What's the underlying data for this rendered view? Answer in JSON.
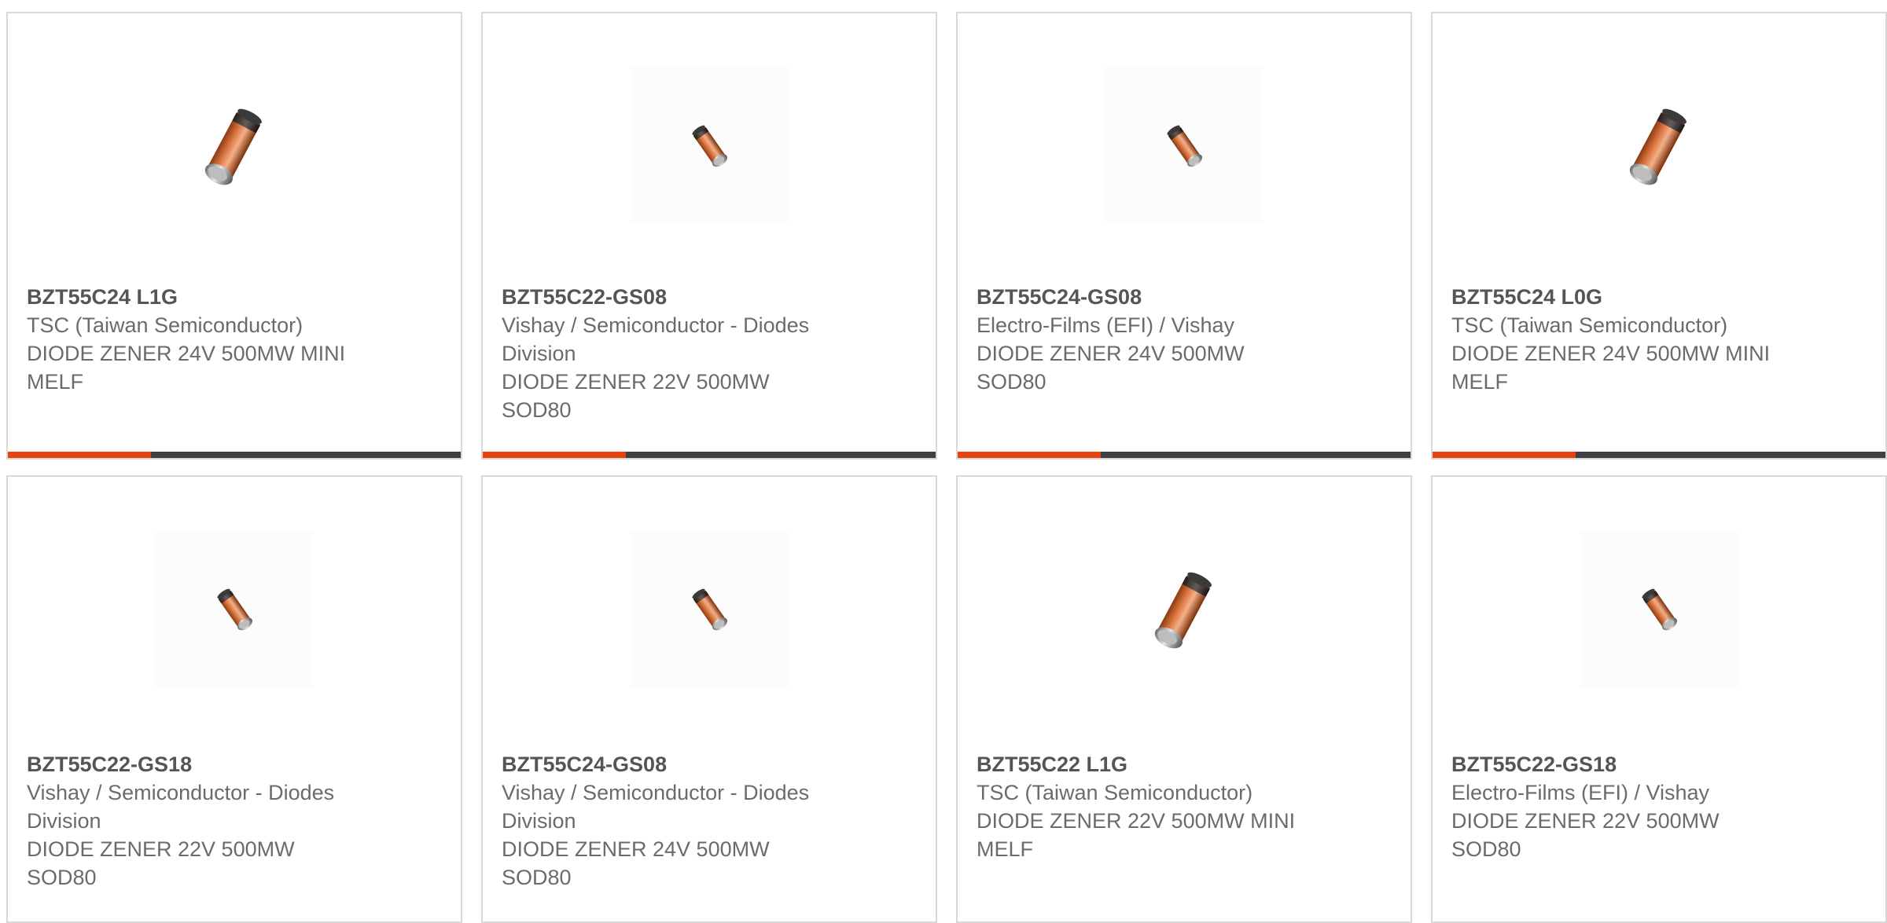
{
  "accent_color": "#e8420e",
  "bar_color": "#3f3f3f",
  "products": [
    {
      "part_number": "BZT55C24 L1G",
      "manufacturer": "TSC (Taiwan Semiconductor)",
      "description": "DIODE ZENER 24V 500MW MINI MELF",
      "image": "diode-large-icon"
    },
    {
      "part_number": "BZT55C22-GS08",
      "manufacturer": "Vishay / Semiconductor - Diodes Division",
      "description": "DIODE ZENER 22V 500MW SOD80",
      "image": "diode-small-icon"
    },
    {
      "part_number": "BZT55C24-GS08",
      "manufacturer": "Electro-Films (EFI) / Vishay",
      "description": "DIODE ZENER 24V 500MW SOD80",
      "image": "diode-small-icon"
    },
    {
      "part_number": "BZT55C24 L0G",
      "manufacturer": "TSC (Taiwan Semiconductor)",
      "description": "DIODE ZENER 24V 500MW MINI MELF",
      "image": "diode-large-icon"
    },
    {
      "part_number": "BZT55C22-GS18",
      "manufacturer": "Vishay / Semiconductor - Diodes Division",
      "description": "DIODE ZENER 22V 500MW SOD80",
      "image": "diode-small-icon"
    },
    {
      "part_number": "BZT55C24-GS08",
      "manufacturer": "Vishay / Semiconductor - Diodes Division",
      "description": "DIODE ZENER 24V 500MW SOD80",
      "image": "diode-small-icon"
    },
    {
      "part_number": "BZT55C22 L1G",
      "manufacturer": "TSC (Taiwan Semiconductor)",
      "description": "DIODE ZENER 22V 500MW MINI MELF",
      "image": "diode-large-icon"
    },
    {
      "part_number": "BZT55C22-GS18",
      "manufacturer": "Electro-Films (EFI) / Vishay",
      "description": "DIODE ZENER 22V 500MW SOD80",
      "image": "diode-small-icon"
    }
  ]
}
